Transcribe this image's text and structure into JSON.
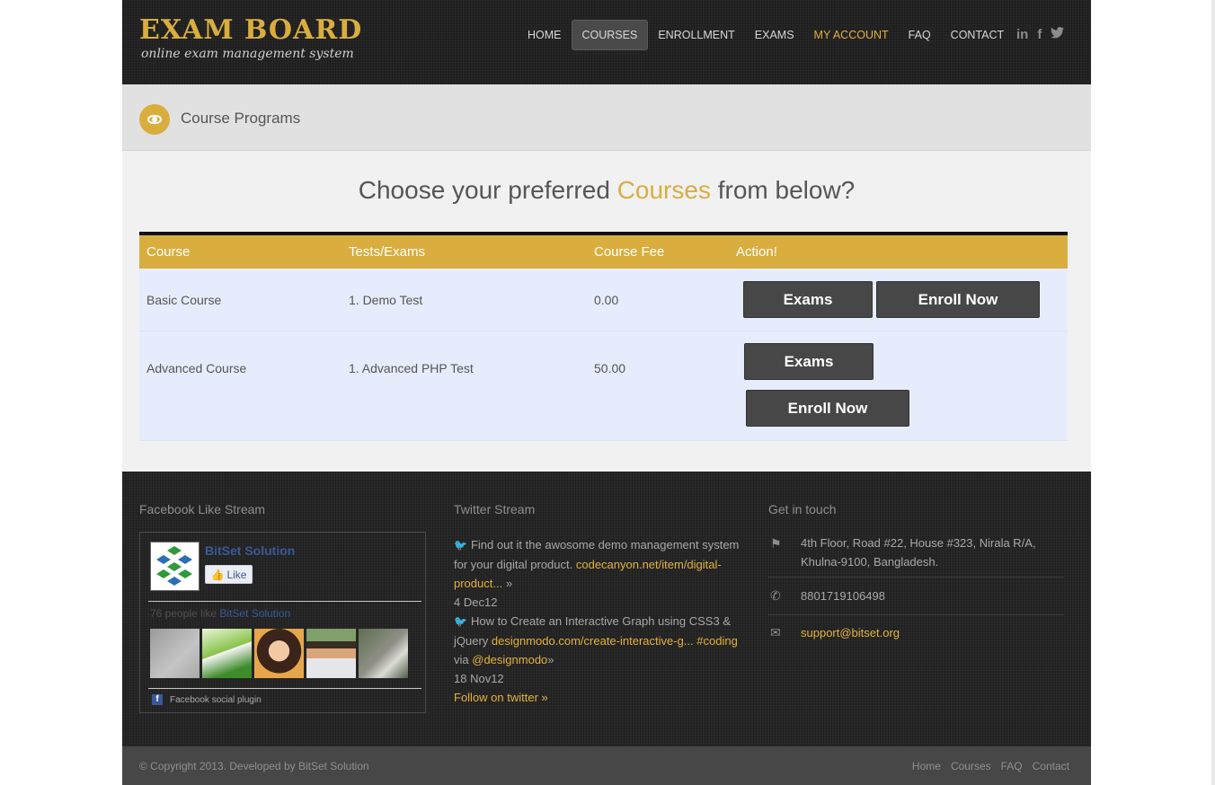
{
  "brand": {
    "title": "EXAM BOARD",
    "tagline": "online exam management system",
    "accent": "#d9ae3f"
  },
  "nav": {
    "items": [
      "HOME",
      "COURSES",
      "ENROLLMENT",
      "EXAMS",
      "MY ACCOUNT",
      "FAQ",
      "CONTACT"
    ],
    "active": "COURSES",
    "highlight": "MY ACCOUNT"
  },
  "social": [
    "in",
    "f",
    "twitter-icon"
  ],
  "page_title": "Course Programs",
  "headline": {
    "prefix": "Choose your preferred ",
    "highlight": "Courses",
    "suffix": " from below?"
  },
  "table": {
    "headers": [
      "Course",
      "Tests/Exams",
      "Course Fee",
      "Action!"
    ],
    "rows": [
      {
        "course": "Basic Course",
        "tests": "1. Demo Test",
        "fee": "0.00",
        "exams_label": "Exams",
        "enroll_label": "Enroll Now"
      },
      {
        "course": "Advanced Course",
        "tests": "1. Advanced PHP Test",
        "fee": "50.00",
        "exams_label": "Exams",
        "enroll_label": "Enroll Now"
      }
    ]
  },
  "footer": {
    "facebook": {
      "title": "Facebook Like Stream",
      "page_name": "BitSet Solution",
      "like_label": "Like",
      "people_count": "76 people like",
      "people_link": "BitSet Solution",
      "plugin": "Facebook social plugin"
    },
    "twitter": {
      "title": "Twitter Stream",
      "tweet1_text": "Find out it the awosome demo management system for your digital product.",
      "tweet1_link": "codecanyon.net/item/digital-product...",
      "tweet1_date": "4 Dec12",
      "tweet2_text": "How to Create an Interactive Graph using CSS3 & jQuery",
      "tweet2_link": "designmodo.com/create-interactive-g...",
      "tweet2_tag": "#coding",
      "tweet2_via": "via",
      "tweet2_user": "@designmodo",
      "tweet2_date": "18 Nov12",
      "follow": "Follow on twitter »"
    },
    "contact": {
      "title": "Get in touch",
      "address": "4th Floor, Road #22, House #323, Nirala R/A, Khulna-9100, Bangladesh.",
      "phone": "8801719106498",
      "email": "support@bitset.org"
    }
  },
  "bottom": {
    "copyright": "© Copyright 2013. Developed by BitSet Solution",
    "links": [
      "Home",
      "Courses",
      "FAQ",
      "Contact"
    ]
  }
}
